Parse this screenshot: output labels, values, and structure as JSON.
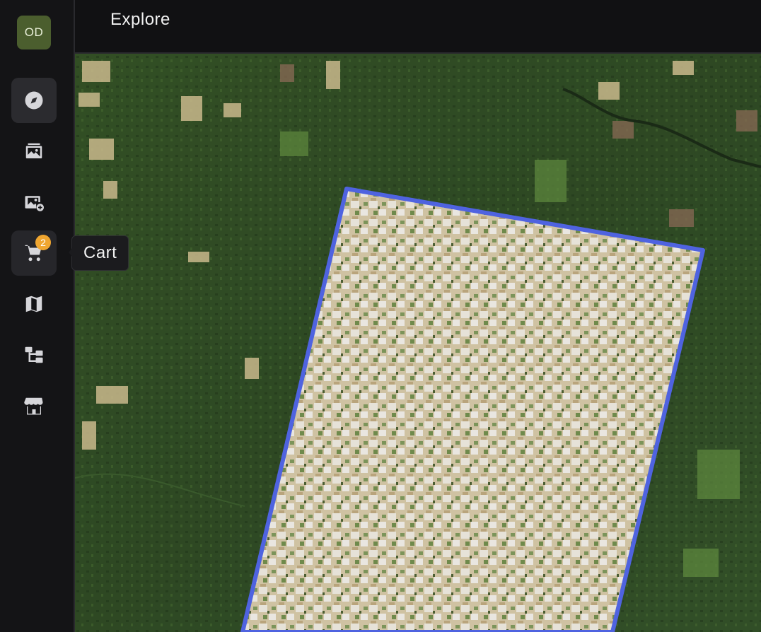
{
  "user": {
    "initials": "OD"
  },
  "header": {
    "title": "Explore"
  },
  "nav": {
    "items": [
      {
        "id": "explore",
        "icon": "compass-icon",
        "active": true
      },
      {
        "id": "gallery",
        "icon": "image-gallery-icon"
      },
      {
        "id": "add-image",
        "icon": "image-add-icon"
      },
      {
        "id": "cart",
        "icon": "cart-icon",
        "badge": "2",
        "tooltip": "Cart"
      },
      {
        "id": "map",
        "icon": "map-icon"
      },
      {
        "id": "workflows",
        "icon": "hierarchy-icon"
      },
      {
        "id": "store",
        "icon": "storefront-icon"
      }
    ]
  },
  "map": {
    "footprint_color": "#4f63e0",
    "imagery": "satellite-forest"
  }
}
